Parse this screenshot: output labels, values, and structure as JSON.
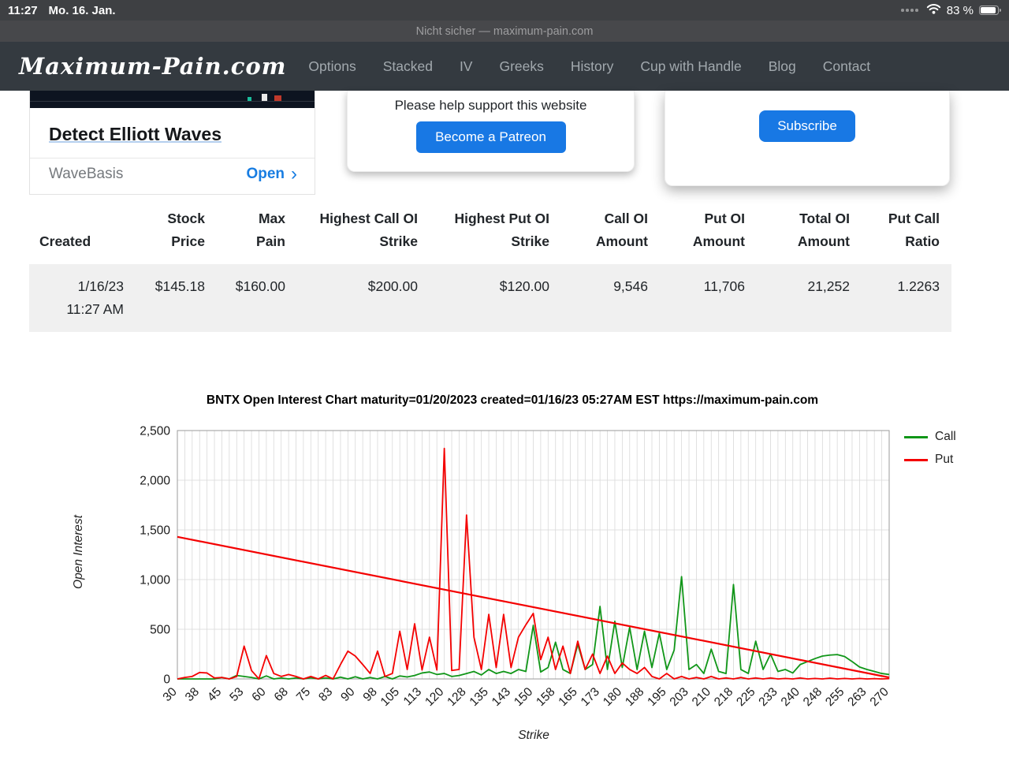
{
  "status_bar": {
    "time": "11:27",
    "date": "Mo. 16. Jan.",
    "battery": "83 %"
  },
  "browser": {
    "security_label": "Nicht sicher — maximum-pain.com"
  },
  "navbar": {
    "brand": "Maximum-Pain.com",
    "items": [
      "Options",
      "Stacked",
      "IV",
      "Greeks",
      "History",
      "Cup with Handle",
      "Blog",
      "Contact"
    ]
  },
  "cards": {
    "elliott": {
      "title": "Detect Elliott Waves",
      "provider": "WaveBasis",
      "open_label": "Open",
      "chevron": "›"
    },
    "support": {
      "message": "Please help support this website",
      "button": "Become a Patreon"
    },
    "newsletter": {
      "button": "Subscribe"
    }
  },
  "accent_color": "#1878e4",
  "table": {
    "headers": [
      "Created",
      "Stock\nPrice",
      "Max\nPain",
      "Highest Call OI\nStrike",
      "Highest Put OI\nStrike",
      "Call OI\nAmount",
      "Put OI\nAmount",
      "Total OI\nAmount",
      "Put Call\nRatio"
    ],
    "rows": [
      [
        "1/16/23\n11:27 AM",
        "$145.18",
        "$160.00",
        "$200.00",
        "$120.00",
        "9,546",
        "11,706",
        "21,252",
        "1.2263"
      ]
    ]
  },
  "chart_data": {
    "type": "line",
    "title": "BNTX Open Interest Chart maturity=01/20/2023 created=01/16/23 05:27AM EST https://maximum-pain.com",
    "xlabel": "Strike",
    "ylabel": "Open Interest",
    "ylim": [
      0,
      2500
    ],
    "ytick_step": 500,
    "x_start": 30,
    "x_end": 270,
    "x_step": 2.5,
    "x_label_every": 3,
    "grid": true,
    "legend_position": "right",
    "legend": [
      {
        "label": "Call",
        "color": "#109618"
      },
      {
        "label": "Put",
        "color": "#f40000"
      }
    ],
    "series": [
      {
        "name": "Call",
        "color": "#109618",
        "sparse": true,
        "width": 1.8,
        "points": [
          [
            45,
            15
          ],
          [
            50,
            35
          ],
          [
            52.5,
            25
          ],
          [
            55,
            15
          ],
          [
            60,
            30
          ],
          [
            65,
            10
          ],
          [
            70,
            10
          ],
          [
            75,
            12
          ],
          [
            80,
            10
          ],
          [
            85,
            18
          ],
          [
            90,
            22
          ],
          [
            95,
            15
          ],
          [
            100,
            25
          ],
          [
            105,
            30
          ],
          [
            107.5,
            20
          ],
          [
            110,
            35
          ],
          [
            112.5,
            60
          ],
          [
            115,
            70
          ],
          [
            117.5,
            45
          ],
          [
            120,
            55
          ],
          [
            122.5,
            25
          ],
          [
            125,
            35
          ],
          [
            127.5,
            55
          ],
          [
            130,
            75
          ],
          [
            132.5,
            40
          ],
          [
            135,
            95
          ],
          [
            137.5,
            55
          ],
          [
            140,
            75
          ],
          [
            142.5,
            55
          ],
          [
            145,
            95
          ],
          [
            147.5,
            75
          ],
          [
            150,
            540
          ],
          [
            152.5,
            70
          ],
          [
            155,
            115
          ],
          [
            157.5,
            370
          ],
          [
            160,
            95
          ],
          [
            162.5,
            55
          ],
          [
            165,
            350
          ],
          [
            167.5,
            95
          ],
          [
            170,
            145
          ],
          [
            172.5,
            730
          ],
          [
            175,
            95
          ],
          [
            177.5,
            580
          ],
          [
            180,
            115
          ],
          [
            182.5,
            520
          ],
          [
            185,
            95
          ],
          [
            187.5,
            480
          ],
          [
            190,
            115
          ],
          [
            192.5,
            460
          ],
          [
            195,
            95
          ],
          [
            197.5,
            290
          ],
          [
            200,
            1030
          ],
          [
            202.5,
            95
          ],
          [
            205,
            145
          ],
          [
            207.5,
            55
          ],
          [
            210,
            300
          ],
          [
            212.5,
            75
          ],
          [
            215,
            55
          ],
          [
            217.5,
            950
          ],
          [
            220,
            95
          ],
          [
            222.5,
            55
          ],
          [
            225,
            380
          ],
          [
            227.5,
            95
          ],
          [
            230,
            250
          ],
          [
            232.5,
            75
          ],
          [
            235,
            95
          ],
          [
            237.5,
            60
          ],
          [
            240,
            145
          ],
          [
            242.5,
            175
          ],
          [
            245,
            205
          ],
          [
            247.5,
            230
          ],
          [
            250,
            240
          ],
          [
            252.5,
            245
          ],
          [
            255,
            225
          ],
          [
            257.5,
            175
          ],
          [
            260,
            120
          ],
          [
            262.5,
            95
          ],
          [
            265,
            75
          ],
          [
            267.5,
            55
          ],
          [
            270,
            45
          ]
        ]
      },
      {
        "name": "Put",
        "color": "#f40000",
        "sparse": true,
        "width": 1.8,
        "points": [
          [
            32.5,
            15
          ],
          [
            35,
            25
          ],
          [
            37.5,
            65
          ],
          [
            40,
            60
          ],
          [
            42.5,
            10
          ],
          [
            45,
            15
          ],
          [
            50,
            25
          ],
          [
            52.5,
            330
          ],
          [
            55,
            85
          ],
          [
            60,
            235
          ],
          [
            62.5,
            55
          ],
          [
            65,
            25
          ],
          [
            67.5,
            45
          ],
          [
            70,
            25
          ],
          [
            75,
            25
          ],
          [
            80,
            35
          ],
          [
            85,
            145
          ],
          [
            87.5,
            280
          ],
          [
            90,
            230
          ],
          [
            92.5,
            145
          ],
          [
            95,
            55
          ],
          [
            97.5,
            280
          ],
          [
            100,
            25
          ],
          [
            102.5,
            55
          ],
          [
            105,
            480
          ],
          [
            107.5,
            95
          ],
          [
            110,
            555
          ],
          [
            112.5,
            90
          ],
          [
            115,
            420
          ],
          [
            117.5,
            90
          ],
          [
            120,
            2320
          ],
          [
            122.5,
            85
          ],
          [
            125,
            95
          ],
          [
            127.5,
            1650
          ],
          [
            130,
            420
          ],
          [
            132.5,
            95
          ],
          [
            135,
            650
          ],
          [
            137.5,
            115
          ],
          [
            140,
            650
          ],
          [
            142.5,
            115
          ],
          [
            145,
            420
          ],
          [
            147.5,
            545
          ],
          [
            150,
            660
          ],
          [
            152.5,
            195
          ],
          [
            155,
            420
          ],
          [
            157.5,
            95
          ],
          [
            160,
            330
          ],
          [
            162.5,
            55
          ],
          [
            165,
            380
          ],
          [
            167.5,
            95
          ],
          [
            170,
            250
          ],
          [
            172.5,
            55
          ],
          [
            175,
            230
          ],
          [
            177.5,
            55
          ],
          [
            180,
            160
          ],
          [
            182.5,
            95
          ],
          [
            185,
            55
          ],
          [
            187.5,
            115
          ],
          [
            190,
            25
          ],
          [
            195,
            55
          ],
          [
            200,
            25
          ],
          [
            205,
            15
          ],
          [
            210,
            25
          ],
          [
            215,
            10
          ],
          [
            220,
            15
          ],
          [
            225,
            10
          ],
          [
            230,
            10
          ],
          [
            235,
            5
          ],
          [
            240,
            10
          ],
          [
            245,
            5
          ],
          [
            250,
            8
          ],
          [
            255,
            5
          ],
          [
            260,
            5
          ],
          [
            265,
            3
          ],
          [
            270,
            3
          ]
        ]
      },
      {
        "name": "Put trend",
        "color": "#f40000",
        "sparse": false,
        "width": 2.2,
        "points": [
          [
            30,
            1430
          ],
          [
            270,
            15
          ]
        ]
      }
    ]
  }
}
